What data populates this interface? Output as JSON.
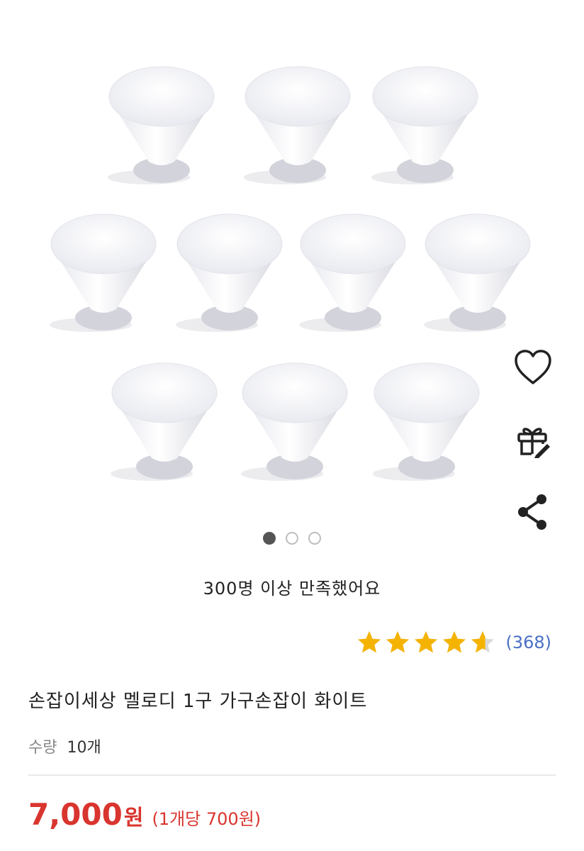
{
  "gallery": {
    "image_label": "white cone furniture knobs",
    "knob_count": 10,
    "pager": {
      "total": 3,
      "active": 1
    }
  },
  "actions": [
    "heart-icon",
    "gift-icon",
    "share-icon"
  ],
  "satisfaction_text": "300명 이상 만족했어요",
  "rating": {
    "value": 4.6,
    "max": 5,
    "review_count": "(368)"
  },
  "product": {
    "title": "손잡이세상 멜로디 1구 가구손잡이 화이트",
    "quantity_label": "수량",
    "quantity_value": "10개",
    "price": "7,000",
    "currency": "원",
    "unit_price": "(1개당 700원)"
  },
  "colors": {
    "price_red": "#d9352f",
    "star_gold": "#f5b301",
    "link_blue": "#4a6fc4"
  }
}
